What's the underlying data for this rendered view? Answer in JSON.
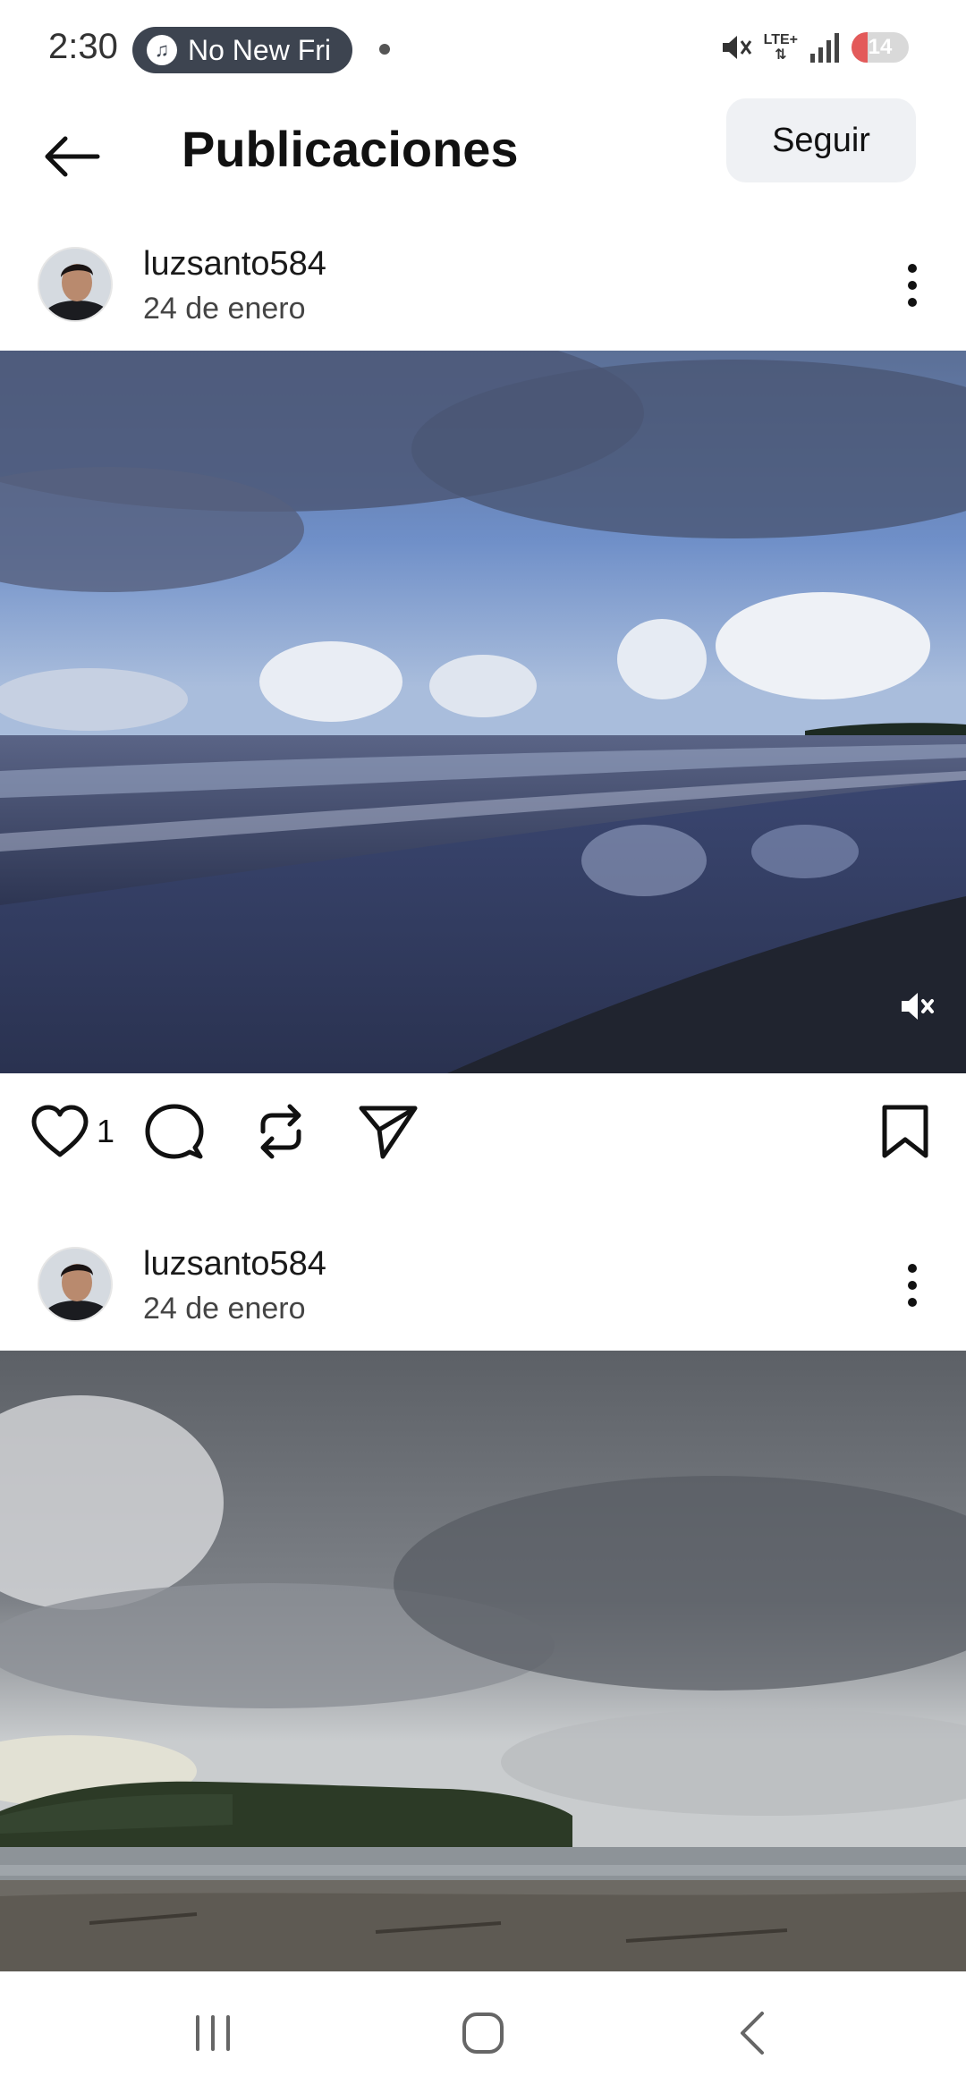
{
  "status_bar": {
    "time": "2:30",
    "pill_text": "No New Fri",
    "network": "LTE+",
    "battery": "14"
  },
  "header": {
    "title": "Publicaciones",
    "follow_label": "Seguir"
  },
  "posts": [
    {
      "username": "luzsanto584",
      "date": "24 de enero",
      "like_count": "1",
      "media_kind": "video"
    },
    {
      "username": "luzsanto584",
      "date": "24 de enero"
    }
  ],
  "icons": {
    "back": "arrow-left-icon",
    "more": "more-vertical-icon",
    "like": "heart-icon",
    "comment": "comment-icon",
    "repost": "repost-icon",
    "share": "send-icon",
    "save": "bookmark-icon",
    "mute": "speaker-muted-icon",
    "nav_recents": "recents-icon",
    "nav_home": "home-icon",
    "nav_back": "chevron-left-icon"
  },
  "colors": {
    "follow_button_bg": "#eff1f4",
    "pill_bg": "#3d4450",
    "battery_low": "#e35a5a"
  }
}
